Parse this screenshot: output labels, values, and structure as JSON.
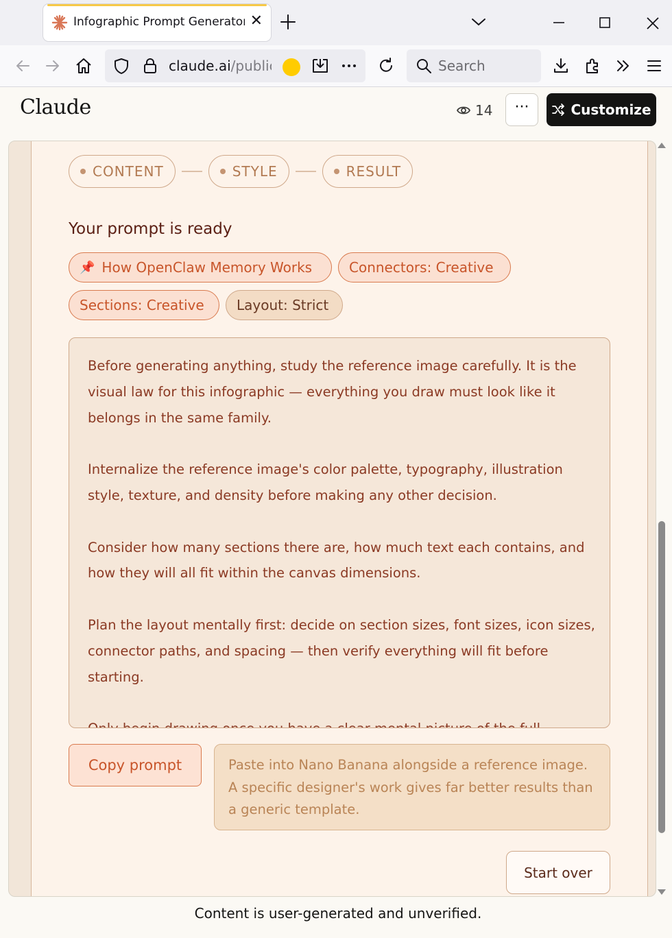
{
  "browser": {
    "tab_title": "Infographic Prompt Generator for Nano Banana",
    "url_host": "claude.ai",
    "url_path": "/public/",
    "search_placeholder": "Search"
  },
  "header": {
    "logo": "Claude",
    "view_count": "14",
    "more_label": "···",
    "customize_label": "Customize"
  },
  "app": {
    "steps": [
      "CONTENT",
      "STYLE",
      "RESULT"
    ],
    "heading": "Your prompt is ready",
    "tags": {
      "topic": "How OpenClaw Memory Works",
      "connectors": "Connectors: Creative",
      "sections": "Sections: Creative",
      "layout": "Layout: Strict"
    },
    "prompt_paragraphs": [
      "Before generating anything, study the reference image carefully. It is the visual law for this infographic — everything you draw must look like it belongs in the same family.",
      "Internalize the reference image's color palette, typography, illustration style, texture, and density before making any other decision.",
      "Consider how many sections there are, how much text each contains, and how they will all fit within the canvas dimensions.",
      "Plan the layout mentally first: decide on section sizes, font sizes, icon sizes, connector paths, and spacing — then verify everything will fit before starting.",
      "Only begin drawing once you have a clear mental picture of the full"
    ],
    "copy_label": "Copy prompt",
    "tip": "Paste into Nano Banana alongside a reference image. A specific designer's work gives far better results than a generic template.",
    "restart_label": "Start over"
  },
  "footer": "Content is user-generated and unverified.",
  "colors": {
    "accent": "#c8552a",
    "panel": "#fdf3ea",
    "heading": "#5b1f14"
  }
}
